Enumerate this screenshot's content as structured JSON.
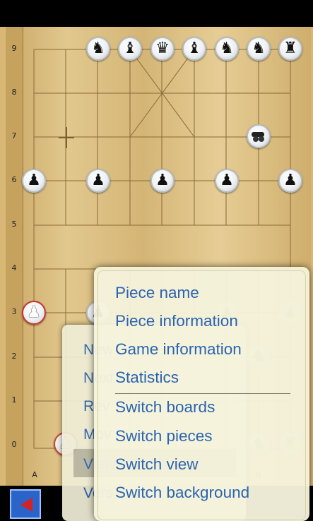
{
  "board": {
    "ranks": [
      "9",
      "8",
      "7",
      "6",
      "5",
      "4",
      "3",
      "2",
      "1",
      "0"
    ],
    "files_visible": [
      "A",
      "H"
    ]
  },
  "pieces": {
    "top_row": [
      "horse",
      "bishop",
      "advisor-head",
      "bishop",
      "horse",
      "knight",
      "rook"
    ],
    "cannon": "cannon",
    "pawns_row6": [
      "pawn",
      "pawn",
      "pawn",
      "pawn",
      "pawn"
    ],
    "red_pawn": "pawn",
    "faded": [
      "pawn",
      "pawn",
      "horse",
      "knight",
      "rook"
    ]
  },
  "back_menu": {
    "items": [
      "New",
      "Next",
      "Rev",
      "Mov",
      "View",
      "Vers"
    ]
  },
  "front_menu": {
    "items": [
      "Piece name",
      "Piece information",
      "Game information",
      "Statistics",
      "Switch boards",
      "Switch pieces",
      "Switch view",
      "Switch background"
    ]
  },
  "colors": {
    "menu_text": "#2b64b1",
    "back_button": "#2a64c8",
    "board": "#d9b877"
  },
  "icons": {
    "back": "back-arrow-icon",
    "cursor": "crosshair-icon"
  }
}
